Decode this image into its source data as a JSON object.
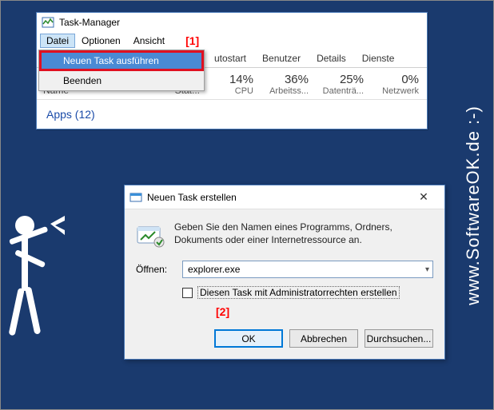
{
  "watermark": "www.SoftwareOK.de :-)",
  "markers": {
    "one": "[1]",
    "two": "[2]"
  },
  "taskmgr": {
    "title": "Task-Manager",
    "menu": {
      "file": "Datei",
      "options": "Optionen",
      "view": "Ansicht"
    },
    "dropdown": {
      "run": "Neuen Task ausführen",
      "exit": "Beenden"
    },
    "tabs": {
      "autostart": "utostart",
      "users": "Benutzer",
      "details": "Details",
      "services": "Dienste"
    },
    "headers": {
      "name": "Name",
      "status": "Stat..."
    },
    "stats": {
      "cpu": {
        "pct": "14%",
        "label": "CPU"
      },
      "memory": {
        "pct": "36%",
        "label": "Arbeitss..."
      },
      "disk": {
        "pct": "25%",
        "label": "Datenträ..."
      },
      "net": {
        "pct": "0%",
        "label": "Netzwerk"
      }
    },
    "apps": "Apps (12)"
  },
  "rundlg": {
    "title": "Neuen Task erstellen",
    "desc": "Geben Sie den Namen eines Programms, Ordners, Dokuments oder einer Internetressource an.",
    "open_label": "Öffnen:",
    "open_value": "explorer.exe",
    "admin_label": "Diesen Task mit Administratorrechten erstellen",
    "ok": "OK",
    "cancel": "Abbrechen",
    "browse": "Durchsuchen..."
  }
}
